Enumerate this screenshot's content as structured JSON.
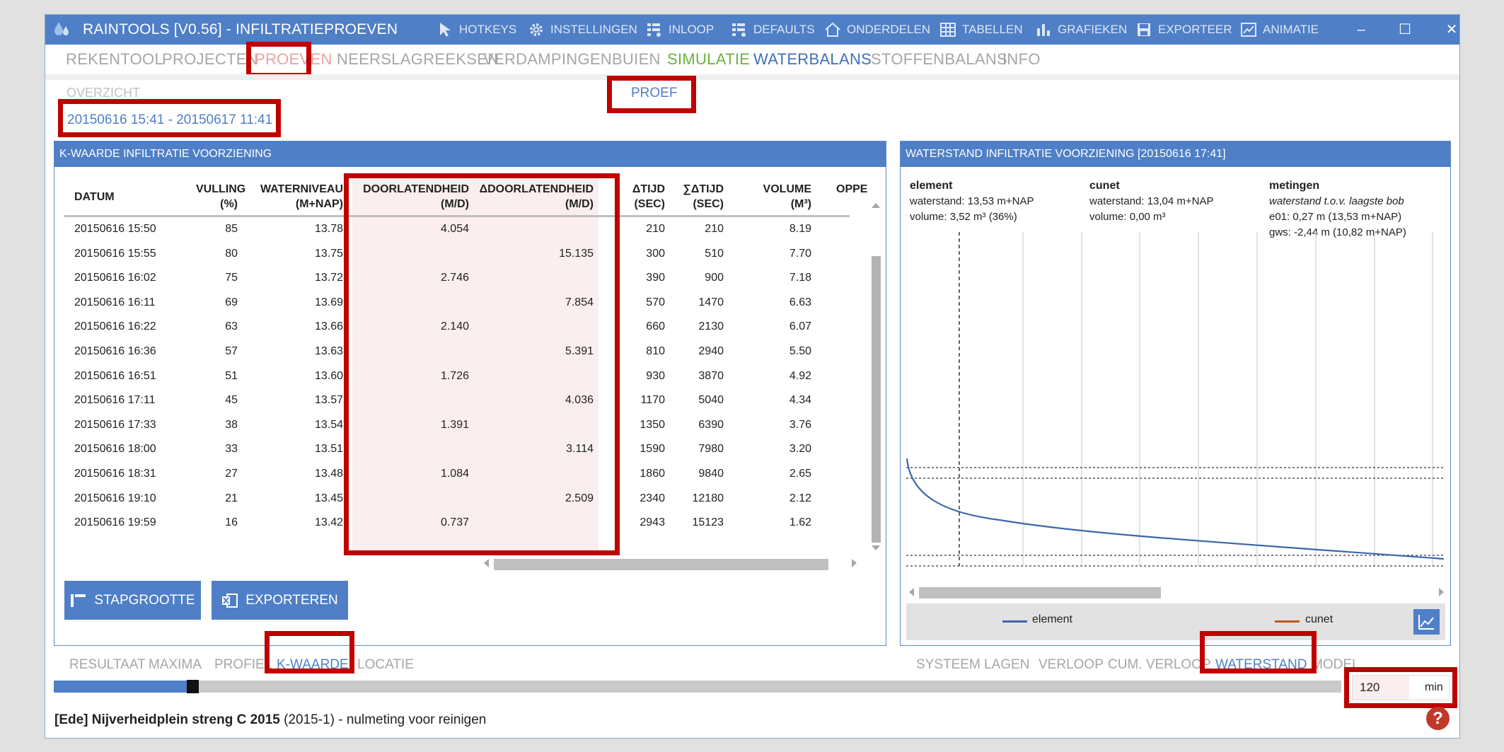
{
  "app": {
    "title": "RAINTOOLS [V0.56] - INFILTRATIEPROEVEN",
    "toolbar": [
      {
        "label": "HOTKEYS",
        "icon": "cursor-icon"
      },
      {
        "label": "INSTELLINGEN",
        "icon": "gear-icon"
      },
      {
        "label": "INLOOP",
        "icon": "list-settings-icon"
      },
      {
        "label": "DEFAULTS",
        "icon": "list-settings-icon"
      },
      {
        "label": "ONDERDELEN",
        "icon": "home-icon"
      },
      {
        "label": "TABELLEN",
        "icon": "grid-icon"
      },
      {
        "label": "GRAFIEKEN",
        "icon": "bar-chart-icon"
      },
      {
        "label": "EXPORTEER",
        "icon": "save-icon"
      },
      {
        "label": "ANIMATIE",
        "icon": "picture-chart-icon"
      }
    ],
    "window_controls": {
      "minimize": "–",
      "maximize": "☐",
      "close": "✕"
    }
  },
  "menu": [
    "REKENTOOL",
    "PROJECTEN",
    "PROEVEN",
    "NEERSLAGREEKSEN",
    "VERDAMPINGEN",
    "BUIEN",
    "SIMULATIE",
    "WATERBALANS",
    "STOFFENBALANS",
    "INFO"
  ],
  "menu_active": "PROEVEN",
  "submenu": {
    "overzicht": "OVERZICHT",
    "proef": "PROEF"
  },
  "period": "20150616 15:41 - 20150617 11:41",
  "left_panel": {
    "title": "K-WAARDE INFILTRATIE VOORZIENING",
    "columns": [
      {
        "top": "DATUM",
        "bottom": ""
      },
      {
        "top": "VULLING",
        "bottom": "(%)"
      },
      {
        "top": "WATERNIVEAU",
        "bottom": "(M+NAP)"
      },
      {
        "top": "DOORLATENDHEID",
        "bottom": "(M/D)"
      },
      {
        "top": "ΔDOORLATENDHEID",
        "bottom": "(M/D)"
      },
      {
        "top": "ΔTIJD",
        "bottom": "(SEC)"
      },
      {
        "top": "∑ΔTIJD",
        "bottom": "(SEC)"
      },
      {
        "top": "VOLUME",
        "bottom": "(M³)"
      },
      {
        "top": "OPPE",
        "bottom": ""
      }
    ],
    "rows": [
      [
        "20150616 15:50",
        "85",
        "13.78",
        "4.054",
        "",
        "210",
        "210",
        "8.19"
      ],
      [
        "20150616 15:55",
        "80",
        "13.75",
        "",
        "15.135",
        "300",
        "510",
        "7.70"
      ],
      [
        "20150616 16:02",
        "75",
        "13.72",
        "2.746",
        "",
        "390",
        "900",
        "7.18"
      ],
      [
        "20150616 16:11",
        "69",
        "13.69",
        "",
        "7.854",
        "570",
        "1470",
        "6.63"
      ],
      [
        "20150616 16:22",
        "63",
        "13.66",
        "2.140",
        "",
        "660",
        "2130",
        "6.07"
      ],
      [
        "20150616 16:36",
        "57",
        "13.63",
        "",
        "5.391",
        "810",
        "2940",
        "5.50"
      ],
      [
        "20150616 16:51",
        "51",
        "13.60",
        "1.726",
        "",
        "930",
        "3870",
        "4.92"
      ],
      [
        "20150616 17:11",
        "45",
        "13.57",
        "",
        "4.036",
        "1170",
        "5040",
        "4.34"
      ],
      [
        "20150616 17:33",
        "38",
        "13.54",
        "1.391",
        "",
        "1350",
        "6390",
        "3.76"
      ],
      [
        "20150616 18:00",
        "33",
        "13.51",
        "",
        "3.114",
        "1590",
        "7980",
        "3.20"
      ],
      [
        "20150616 18:31",
        "27",
        "13.48",
        "1.084",
        "",
        "1860",
        "9840",
        "2.65"
      ],
      [
        "20150616 19:10",
        "21",
        "13.45",
        "",
        "2.509",
        "2340",
        "12180",
        "2.12"
      ],
      [
        "20150616 19:59",
        "16",
        "13.42",
        "0.737",
        "",
        "2943",
        "15123",
        "1.62"
      ]
    ],
    "buttons": {
      "stapgrootte": "STAPGROOTTE",
      "exporteren": "EXPORTEREN"
    }
  },
  "left_tabs": [
    "RESULTAAT",
    "MAXIMA",
    "PROFIEL",
    "K-WAARDE",
    "LOCATIE"
  ],
  "left_tab_active": "K-WAARDE",
  "right_panel": {
    "title": "WATERSTAND INFILTRATIE VOORZIENING [20150616 17:41]",
    "info": {
      "element": {
        "label": "element",
        "line1": "waterstand: 13,53 m+NAP",
        "line2": "volume: 3,52 m³ (36%)"
      },
      "cunet": {
        "label": "cunet",
        "line1": "waterstand: 13,04 m+NAP",
        "line2": "volume: 0,00 m³"
      },
      "metingen": {
        "label": "metingen",
        "line1": "waterstand t.o.v. laagste bob",
        "line2": "e01: 0,27 m (13,53 m+NAP)",
        "line3": "gws: -2,44 m (10,82 m+NAP)"
      }
    },
    "legend": {
      "element": "element",
      "cunet": "cunet"
    },
    "colors": {
      "element": "#3d67a8",
      "cunet": "#c0581c"
    }
  },
  "right_tabs": [
    "SYSTEEM",
    "LAGEN",
    "VERLOOP",
    "CUM. VERLOOP",
    "WATERSTAND",
    "MODEL"
  ],
  "right_tab_active": "WATERSTAND",
  "time_slider": {
    "progress": 0.1,
    "value": "120",
    "unit": "min"
  },
  "status": {
    "bold": "[Ede] Nijverheidplein streng C 2015",
    "rest": " (2015-1) - nulmeting voor reinigen"
  }
}
